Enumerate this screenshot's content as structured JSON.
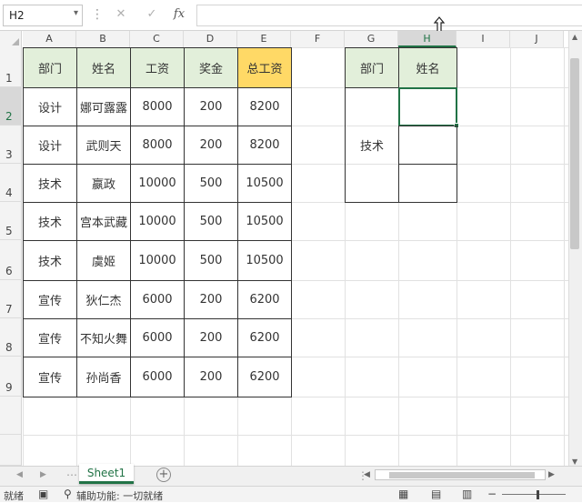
{
  "formula_bar": {
    "name_box": "H2",
    "dropdown_icon": "chevron-down-icon",
    "cancel_icon": "close-icon",
    "enter_icon": "check-icon",
    "fx_label": "fx",
    "formula_value": ""
  },
  "columns": [
    "A",
    "B",
    "C",
    "D",
    "E",
    "F",
    "G",
    "H",
    "I",
    "J"
  ],
  "selected_column": "H",
  "rows": [
    "1",
    "2",
    "3",
    "4",
    "5",
    "6",
    "7",
    "8",
    "9"
  ],
  "selected_row": "2",
  "table": {
    "headers": [
      "部门",
      "姓名",
      "工资",
      "奖金",
      "总工资"
    ],
    "rows": [
      [
        "设计",
        "娜可露露",
        "8000",
        "200",
        "8200"
      ],
      [
        "设计",
        "武则天",
        "8000",
        "200",
        "8200"
      ],
      [
        "技术",
        "嬴政",
        "10000",
        "500",
        "10500"
      ],
      [
        "技术",
        "宫本武藏",
        "10000",
        "500",
        "10500"
      ],
      [
        "技术",
        "虞姬",
        "10000",
        "500",
        "10500"
      ],
      [
        "宣传",
        "狄仁杰",
        "6000",
        "200",
        "6200"
      ],
      [
        "宣传",
        "不知火舞",
        "6000",
        "200",
        "6200"
      ],
      [
        "宣传",
        "孙尚香",
        "6000",
        "200",
        "6200"
      ]
    ]
  },
  "lookup": {
    "headers": [
      "部门",
      "姓名"
    ],
    "department": "技术"
  },
  "sheet_tabs": [
    "Sheet1"
  ],
  "add_sheet_label": "+",
  "status": {
    "ready": "就绪",
    "accessibility": "辅助功能: 一切就绪"
  },
  "colors": {
    "header_fill": "#e2efda",
    "total_header_fill": "#ffd966",
    "accent": "#217346"
  }
}
